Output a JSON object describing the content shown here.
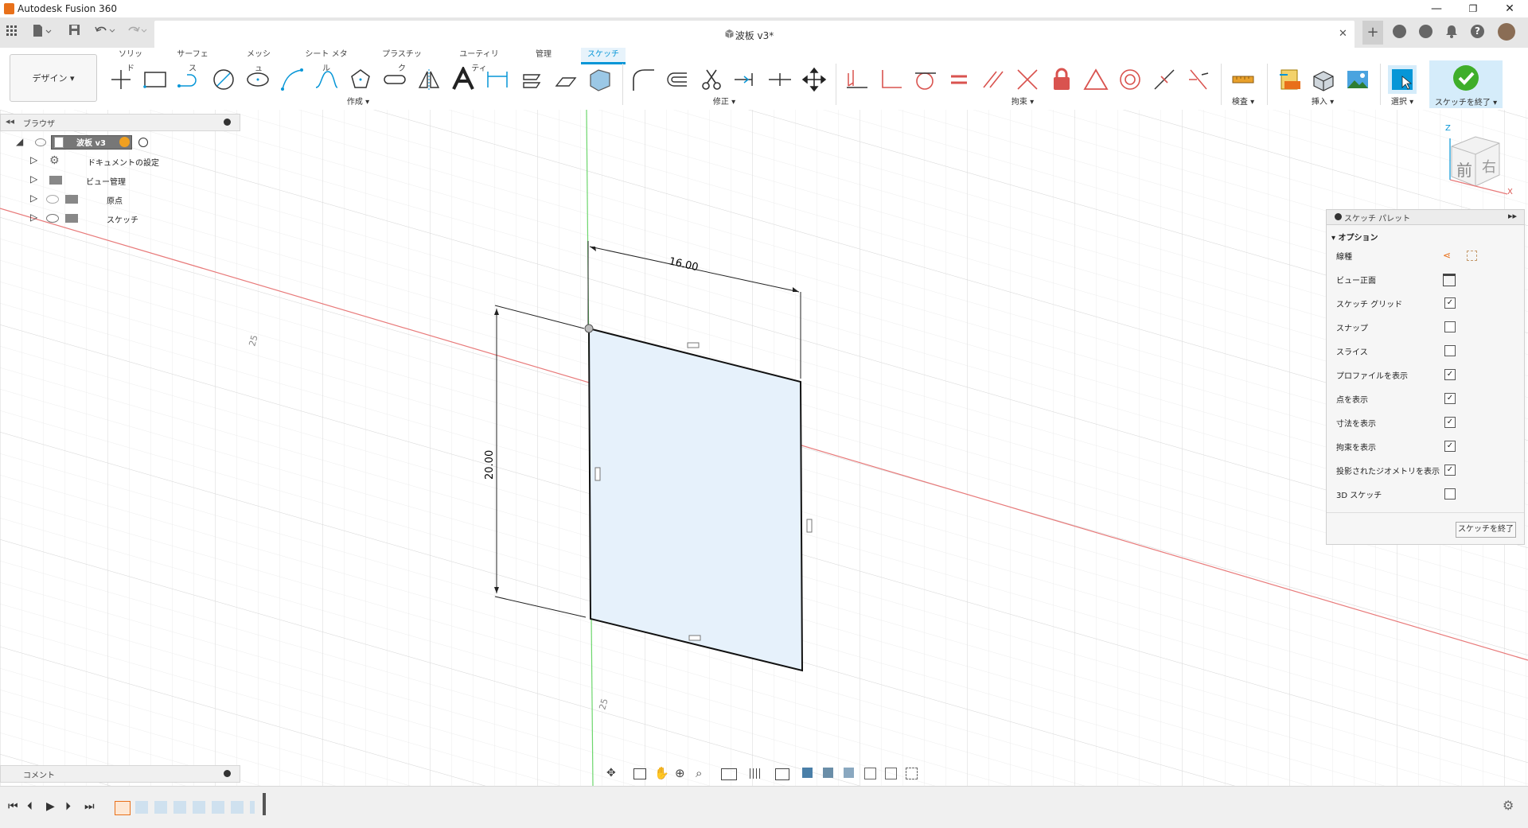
{
  "app": {
    "title": "Autodesk Fusion 360"
  },
  "window_controls": {
    "minimize": "—",
    "maximize": "❐",
    "close": "✕"
  },
  "document": {
    "title": "波板 v3*",
    "close": "✕"
  },
  "toolbar": {
    "workspace": "デザイン ▾",
    "tabs": [
      "ソリッド",
      "サーフェス",
      "メッシュ",
      "シート メタル",
      "プラスチック",
      "ユーティリティ",
      "管理",
      "スケッチ"
    ],
    "active_tab": "スケッチ",
    "groups": {
      "create": "作成 ▾",
      "modify": "修正 ▾",
      "constraints": "拘束 ▾",
      "inspect": "検査 ▾",
      "insert": "挿入 ▾",
      "select": "選択 ▾",
      "finish": "スケッチを終了 ▾"
    }
  },
  "browser": {
    "header": "ブラウザ",
    "root": "波板 v3",
    "items": [
      {
        "label": "ドキュメントの設定",
        "icon": "gear-icon"
      },
      {
        "label": "ビュー管理",
        "icon": "folder-icon"
      },
      {
        "label": "原点",
        "icon": "folder-icon"
      },
      {
        "label": "スケッチ",
        "icon": "folder-icon"
      }
    ]
  },
  "sketch": {
    "dim_width": "16.00",
    "dim_height": "20.00",
    "axis_label_1": "25",
    "axis_label_2": "25"
  },
  "viewcube": {
    "front": "前",
    "right": "右",
    "z": "Z",
    "x": "X"
  },
  "palette": {
    "header": "スケッチ パレット",
    "section": "オプション",
    "rows": [
      {
        "label": "線種",
        "type": "icons"
      },
      {
        "label": "ビュー正面",
        "type": "icon"
      },
      {
        "label": "スケッチ グリッド",
        "checked": true
      },
      {
        "label": "スナップ",
        "checked": false
      },
      {
        "label": "スライス",
        "checked": false
      },
      {
        "label": "プロファイルを表示",
        "checked": true
      },
      {
        "label": "点を表示",
        "checked": true
      },
      {
        "label": "寸法を表示",
        "checked": true
      },
      {
        "label": "拘束を表示",
        "checked": true
      },
      {
        "label": "投影されたジオメトリを表示",
        "checked": true
      },
      {
        "label": "3D スケッチ",
        "checked": false
      }
    ],
    "finish_button": "スケッチを終了"
  },
  "comment": {
    "label": "コメント"
  },
  "colors": {
    "accent": "#0696d7",
    "finish_green": "#3fae2a",
    "sketch_fill": "#e6f1fb",
    "x_axis": "#e87a7a",
    "y_axis": "#6cd66c"
  }
}
